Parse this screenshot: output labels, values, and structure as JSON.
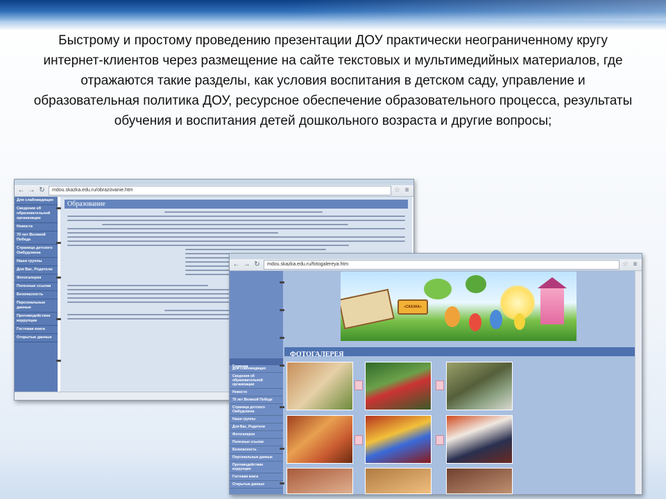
{
  "slide": {
    "heading": "Быстрому и простому проведению презентации ДОУ практически неограниченному кругу интернет-клиентов через размещение на сайте текстовых и мультимедийных материалов, где отражаются такие разделы, как условия воспитания в детском саду, управление и образовательная политика ДОУ, ресурсное обеспечение образовательного процесса, результаты обучения и воспитания детей дошкольного возраста и другие вопросы;"
  },
  "window1": {
    "tab": "Образование",
    "address": "mdou.skazka.edu.ru/obrazovanie.htm",
    "page_title": "Образование",
    "sidebar": [
      "Для слабовидящих",
      "Сведения об образовательной организации",
      "Новости",
      "70 лет Великой Победе",
      "Страница детского Омбудсмена",
      "Наши группы",
      "Для Вас, Родители",
      "Фотогалерея",
      "Полезные ссылки",
      "Безопасность",
      "Персональные данные",
      "Противодействие коррупции",
      "Гостевая книга",
      "Открытые данные"
    ]
  },
  "window2": {
    "tab": "Фотогалерея",
    "address": "mdou.skazka.edu.ru/fotogalereya.htm",
    "menu_header": "Главная",
    "menu": [
      "Для слабовидящих",
      "Сведения об образовательной организации",
      "Новости",
      "70 лет Великой Победе",
      "Страница детского Омбудсмена",
      "Наши группы",
      "Для Вас, Родители",
      "Фотогалерея",
      "Полезные ссылки",
      "Безопасность",
      "Персональные данные",
      "Противодействие коррупции",
      "Гостевая книга",
      "Открытые данные"
    ],
    "gallery_title": "ФОТОГАЛЕРЕЯ",
    "banner_sign": "«СКАЗКА»"
  },
  "colors": {
    "band": "#0d3f86",
    "sidebar": "#5a7bb5",
    "gallery_header": "#4e72b0"
  }
}
